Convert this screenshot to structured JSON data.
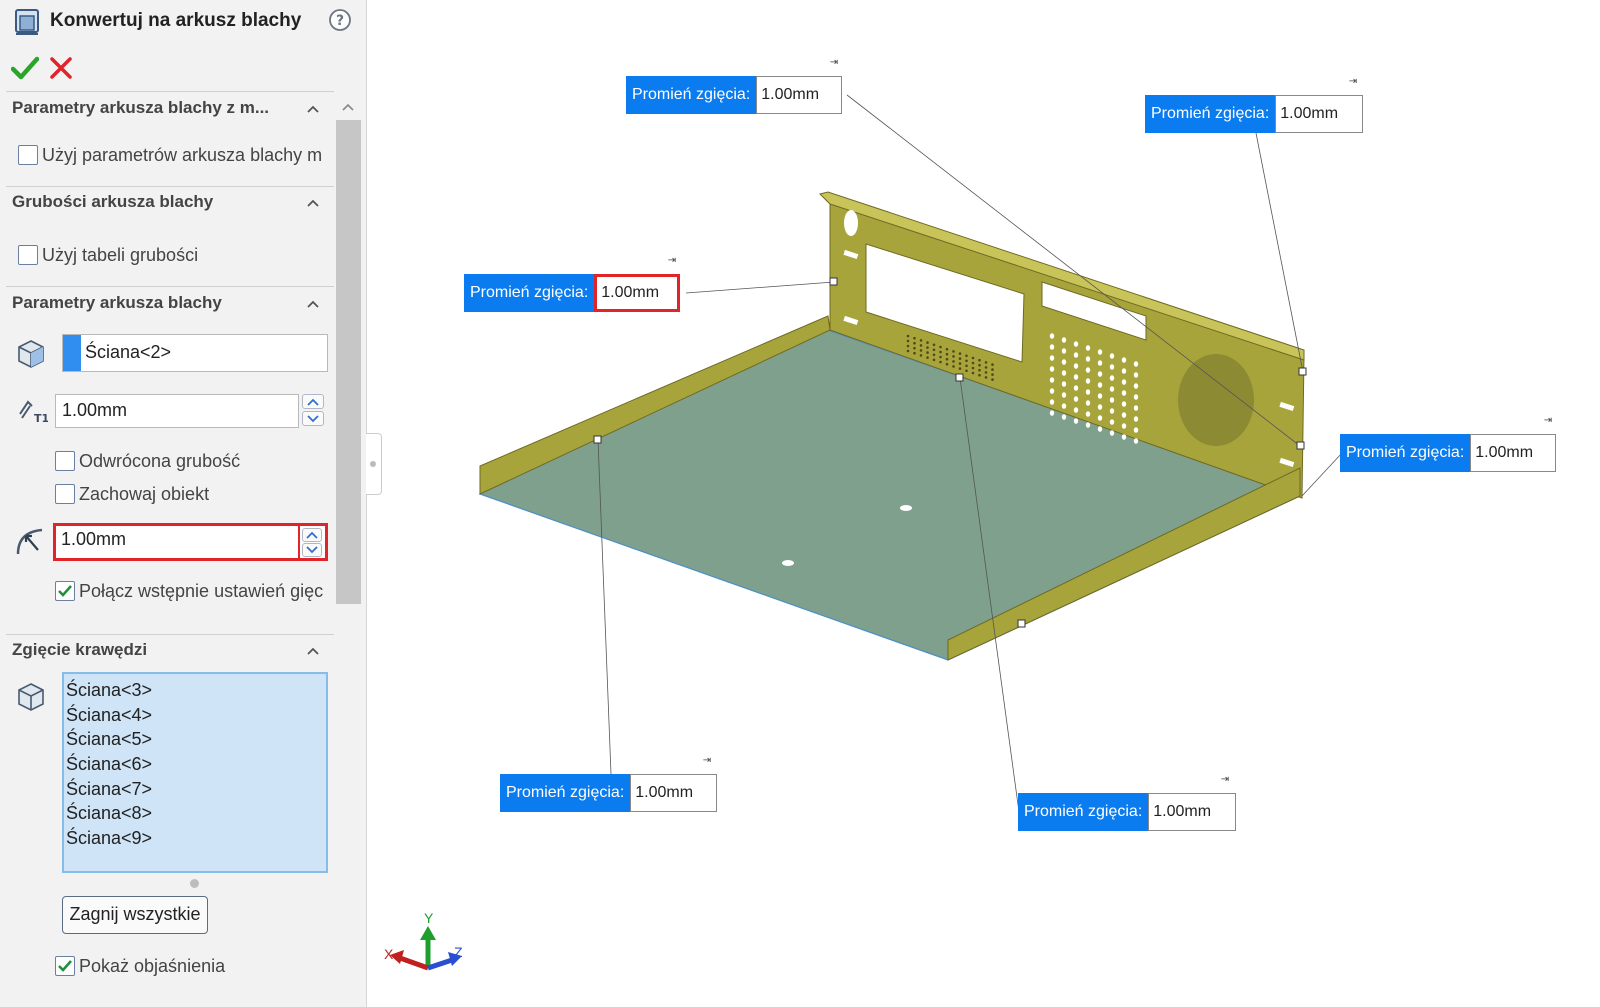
{
  "panel": {
    "title": "Konwertuj na arkusz blachy",
    "sections": {
      "mold_params": {
        "header": "Parametry arkusza blachy z m...",
        "use_params_label": "Użyj parametrów arkusza blachy m",
        "use_params_checked": false
      },
      "gauges": {
        "header": "Grubości arkusza blachy",
        "use_table_label": "Użyj tabeli grubości",
        "use_table_checked": false
      },
      "sheet_params": {
        "header": "Parametry arkusza blachy",
        "fixed_face": "Ściana<2>",
        "thickness": "1.00mm",
        "reverse_label": "Odwrócona grubość",
        "reverse_checked": false,
        "keep_body_label": "Zachowaj obiekt",
        "keep_body_checked": false,
        "bend_radius": "1.00mm",
        "merge_label": "Połącz wstępnie ustawień gięc",
        "merge_checked": true
      },
      "edge_bends": {
        "header": "Zgięcie krawędzi",
        "faces": [
          "Ściana<3>",
          "Ściana<4>",
          "Ściana<5>",
          "Ściana<6>",
          "Ściana<7>",
          "Ściana<8>",
          "Ściana<9>"
        ],
        "fold_all_button": "Zagnij wszystkie",
        "show_callouts_label": "Pokaż objaśnienia",
        "show_callouts_checked": true
      }
    }
  },
  "viewport": {
    "callouts": [
      {
        "label": "Promień zgięcia:",
        "value": "1.00mm"
      },
      {
        "label": "Promień zgięcia:",
        "value": "1.00mm"
      },
      {
        "label": "Promień zgięcia:",
        "value": "1.00mm"
      },
      {
        "label": "Promień zgięcia:",
        "value": "1.00mm"
      },
      {
        "label": "Promień zgięcia:",
        "value": "1.00mm"
      },
      {
        "label": "Promień zgięcia:",
        "value": "1.00mm"
      }
    ],
    "triad": {
      "x": "X",
      "y": "Y",
      "z": "Z"
    },
    "colors": {
      "callout_blue": "#0a7cf0",
      "highlight_red": "#e0242a",
      "flange": "#a8a43c",
      "base": "#7fa08c"
    }
  }
}
